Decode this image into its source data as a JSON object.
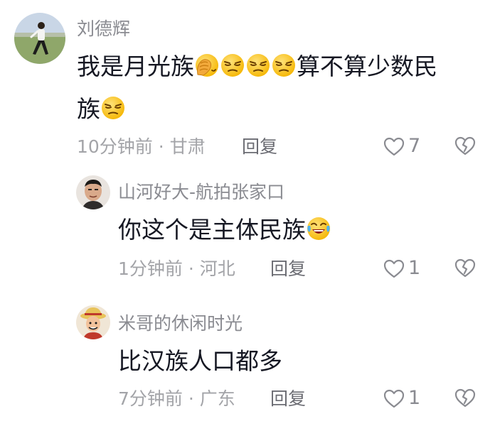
{
  "comments": [
    {
      "username": "刘德辉",
      "text_line1": "我是月光族",
      "text_line1_after": "算不算少数民",
      "text_line2": "族",
      "time": "10分钟前",
      "location": "甘肃",
      "reply_label": "回复",
      "likes": "7"
    },
    {
      "username": "山河好大-航拍张家口",
      "text": "你这个是主体民族",
      "time": "1分钟前",
      "location": "河北",
      "reply_label": "回复",
      "likes": "1"
    },
    {
      "username": "米哥的休闲时光",
      "text": "比汉族人口都多",
      "time": "7分钟前",
      "location": "广东",
      "reply_label": "回复",
      "likes": "1"
    }
  ],
  "meta_separator": "·",
  "icons": {
    "like": "heart-outline-icon",
    "dislike": "broken-heart-icon",
    "emoji_facepalm": "facepalm-emoji",
    "emoji_unamused": "unamused-emoji",
    "emoji_laughing": "laughing-crying-emoji"
  },
  "colors": {
    "username": "#8a8b91",
    "meta": "#a3a4a8",
    "text": "#161823",
    "emoji_yellow": "#ffc928"
  }
}
